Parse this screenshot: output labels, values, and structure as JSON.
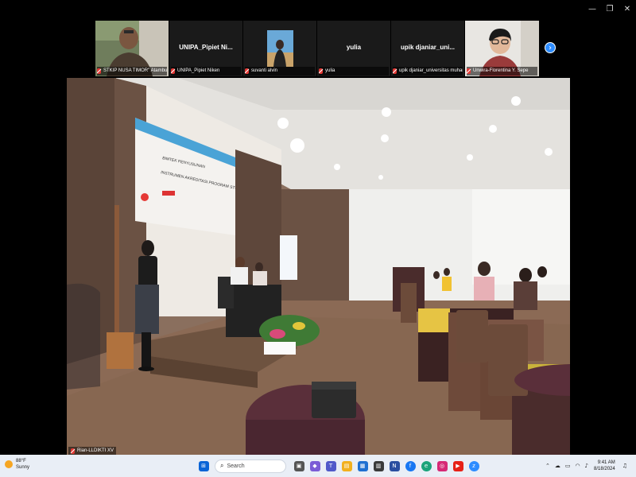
{
  "window": {
    "minimize_glyph": "—",
    "maximize_glyph": "❐",
    "close_glyph": "✕"
  },
  "participants": [
    {
      "display_name": "",
      "label": "STKIP NUSA TIMOR\" Atambua",
      "has_video": true
    },
    {
      "display_name": "UNIPA_Pipiet  Ni...",
      "label": "UNIPA_Pipiet Niken",
      "has_video": false
    },
    {
      "display_name": "",
      "label": "suvanti alvin",
      "has_video": true
    },
    {
      "display_name": "yulia",
      "label": "yulia",
      "has_video": false
    },
    {
      "display_name": "upik  djaniar_uni...",
      "label": "upik djaniar_universitas muham...",
      "has_video": false
    },
    {
      "display_name": "",
      "label": "Unwira-Florentina Y. Sepe",
      "has_video": true
    }
  ],
  "strip_next_glyph": "›",
  "main_video": {
    "speaker_label": "Rian-LLDIKTI XV"
  },
  "taskbar": {
    "weather": {
      "temp": "88°F",
      "condition": "Sunny"
    },
    "search_placeholder": "Search",
    "clock": {
      "time": "9:41 AM",
      "date": "8/18/2024"
    }
  },
  "colors": {
    "zoom_blue": "#2d8cff",
    "mic_muted_red": "#e53935",
    "taskbar_bg": "#e9eef6"
  }
}
